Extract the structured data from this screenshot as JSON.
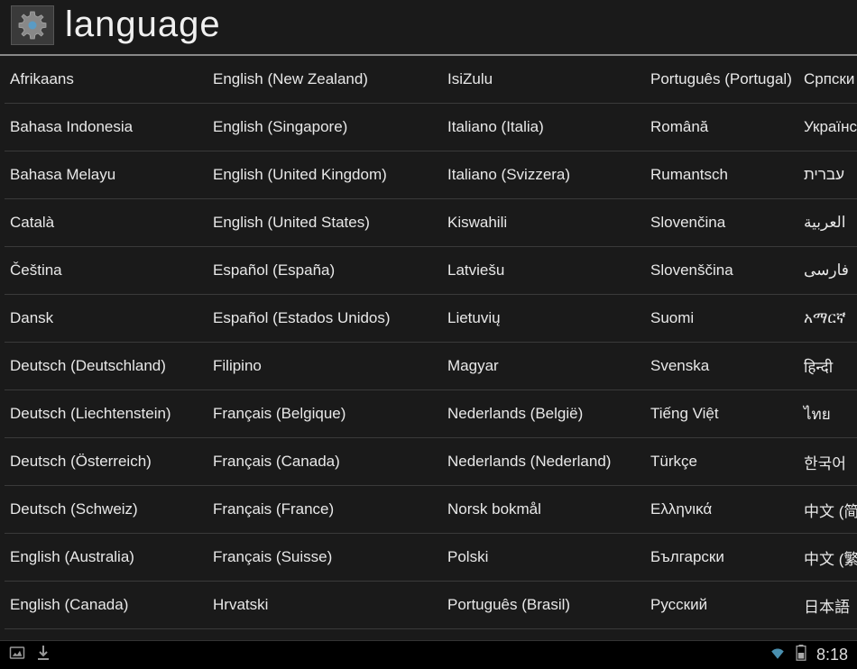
{
  "header": {
    "title": "language"
  },
  "columns": [
    [
      "Afrikaans",
      "Bahasa Indonesia",
      "Bahasa Melayu",
      "Català",
      "Čeština",
      "Dansk",
      "Deutsch (Deutschland)",
      "Deutsch (Liechtenstein)",
      "Deutsch (Österreich)",
      "Deutsch (Schweiz)",
      "English (Australia)",
      "English (Canada)"
    ],
    [
      "English (New Zealand)",
      "English (Singapore)",
      "English (United Kingdom)",
      "English (United States)",
      "Español (España)",
      "Español (Estados Unidos)",
      "Filipino",
      "Français (Belgique)",
      "Français (Canada)",
      "Français (France)",
      "Français (Suisse)",
      "Hrvatski"
    ],
    [
      "IsiZulu",
      "Italiano (Italia)",
      "Italiano (Svizzera)",
      "Kiswahili",
      "Latviešu",
      "Lietuvių",
      "Magyar",
      "Nederlands (België)",
      "Nederlands (Nederland)",
      "Norsk bokmål",
      "Polski",
      "Português (Brasil)"
    ],
    [
      "Português (Portugal)",
      "Română",
      "Rumantsch",
      "Slovenčina",
      "Slovenščina",
      "Suomi",
      "Svenska",
      "Tiếng Việt",
      "Türkçe",
      "Ελληνικά",
      "Български",
      "Русский"
    ],
    [
      "Српски",
      "Українська",
      "עברית",
      "العربية",
      "فارسى",
      "አማርኛ",
      "हिन्दी",
      "ไทย",
      "한국어",
      "中文 (简体)",
      "中文 (繁體)",
      "日本語"
    ]
  ],
  "statusbar": {
    "clock": "8:18"
  }
}
